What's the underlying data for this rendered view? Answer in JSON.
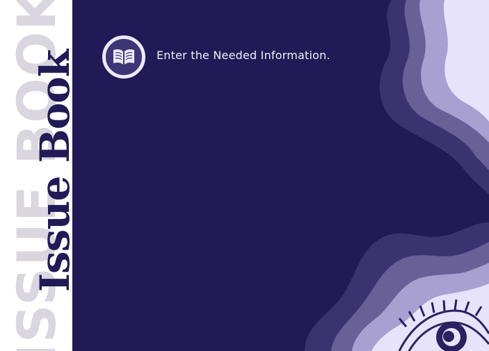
{
  "sidebar": {
    "outline_text": "ISSUE BOOK",
    "title": "Issue Book"
  },
  "main": {
    "icon": "open-book-icon",
    "instruction": "Enter the Needed Information."
  },
  "colors": {
    "background": "#211a56",
    "sidebar": "#ffffff",
    "wave_dark": "#3b3270",
    "wave_mid": "#6a6098",
    "wave_light": "#a8a0d0",
    "wave_lightest": "#e6e3fb"
  }
}
